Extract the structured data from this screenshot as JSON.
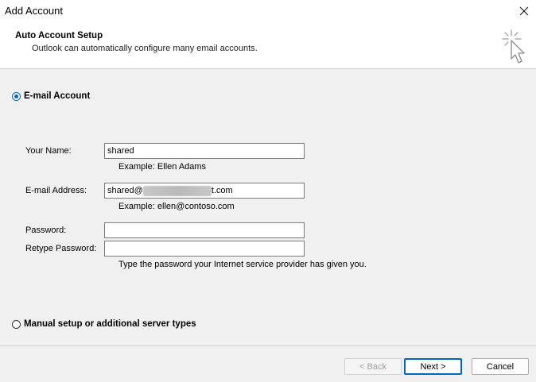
{
  "window": {
    "title": "Add Account"
  },
  "header": {
    "title": "Auto Account Setup",
    "subtitle": "Outlook can automatically configure many email accounts."
  },
  "options": {
    "email_account": {
      "label": "E-mail Account",
      "selected": true
    },
    "manual_setup": {
      "label": "Manual setup or additional server types",
      "selected": false
    }
  },
  "form": {
    "your_name": {
      "label": "Your Name:",
      "value": "shared",
      "example": "Example: Ellen Adams"
    },
    "email": {
      "label": "E-mail Address:",
      "value_prefix": "shared@",
      "value_suffix": "t.com",
      "example": "Example: ellen@contoso.com"
    },
    "password": {
      "label": "Password:",
      "value": ""
    },
    "retype_password": {
      "label": "Retype Password:",
      "value": "",
      "hint": "Type the password your Internet service provider has given you."
    }
  },
  "buttons": {
    "back": "< Back",
    "next": "Next >",
    "cancel": "Cancel"
  },
  "colors": {
    "accent": "#0067c0",
    "background": "#f0f0f0",
    "header_bg": "#ffffff"
  },
  "icons": {
    "close": "close-icon",
    "wizard": "cursor-sparkle-icon"
  }
}
